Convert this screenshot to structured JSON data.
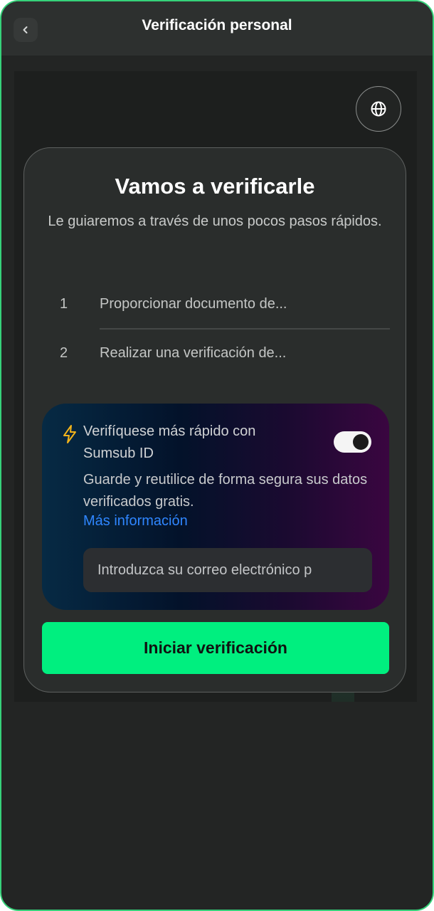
{
  "header": {
    "title": "Verificación personal",
    "back_icon": "chevron-left-icon"
  },
  "language_button": {
    "icon": "globe-icon"
  },
  "card": {
    "title": "Vamos a verificarle",
    "subtitle": "Le guiaremos a través de unos pocos pasos rápidos.",
    "steps": [
      {
        "number": "1",
        "label": "Proporcionar documento de..."
      },
      {
        "number": "2",
        "label": "Realizar una verificación de..."
      }
    ]
  },
  "sumsub": {
    "icon": "lightning-bolt-icon",
    "title": "Verifíquese más rápido con Sumsub ID",
    "toggle_on": true,
    "description": "Guarde y reutilice de forma segura sus datos verificados gratis.",
    "link_label": "Más información",
    "email_placeholder": "Introduzca su correo electrónico p"
  },
  "cta": {
    "label": "Iniciar verificación"
  },
  "colors": {
    "accent_green": "#00ef7f",
    "link_blue": "#2f86ff",
    "frame_border": "#36d27a",
    "bolt_yellow": "#f2b31b"
  }
}
